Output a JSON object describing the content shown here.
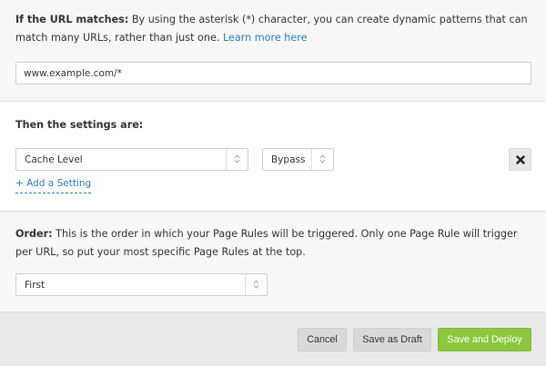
{
  "url_section": {
    "label": "If the URL matches:",
    "description": " By using the asterisk (*) character, you can create dynamic patterns that can match many URLs, rather than just one. ",
    "learn_more": "Learn more here",
    "url_value": "www.example.com/*"
  },
  "settings_section": {
    "heading": "Then the settings are:",
    "setting_name": "Cache Level",
    "setting_value": "Bypass",
    "add_setting": "+ Add a Setting"
  },
  "order_section": {
    "label": "Order:",
    "description": " This is the order in which your Page Rules will be triggered. Only one Page Rule will trigger per URL, so put your most specific Page Rules at the top.",
    "selected": "First"
  },
  "footer": {
    "cancel": "Cancel",
    "save_draft": "Save as Draft",
    "save_deploy": "Save and Deploy"
  },
  "colors": {
    "accent_green": "#8cc63f",
    "link_blue": "#2f7bbf"
  },
  "icons": {
    "remove": "close-icon",
    "select_arrows": "up-down-arrows-icon"
  }
}
